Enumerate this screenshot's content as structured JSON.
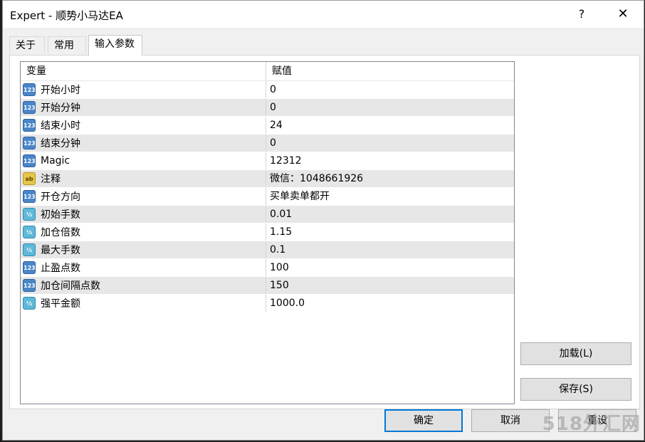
{
  "window": {
    "title": "Expert - 顺势小马达EA",
    "help_label": "?",
    "close_label": "✕"
  },
  "tabs": [
    {
      "label": "关于"
    },
    {
      "label": "常用"
    },
    {
      "label": "输入参数",
      "active": true
    }
  ],
  "grid": {
    "headers": {
      "variable": "变量",
      "value": "赋值"
    },
    "rows": [
      {
        "type": "int",
        "name": "开始小时",
        "value": "0"
      },
      {
        "type": "int",
        "name": "开始分钟",
        "value": "0"
      },
      {
        "type": "int",
        "name": "结束小时",
        "value": "24"
      },
      {
        "type": "int",
        "name": "结束分钟",
        "value": "0"
      },
      {
        "type": "int",
        "name": "Magic",
        "value": "12312"
      },
      {
        "type": "string",
        "name": "注释",
        "value": "微信：1048661926"
      },
      {
        "type": "int",
        "name": "开仓方向",
        "value": "买单卖单都开"
      },
      {
        "type": "double",
        "name": "初始手数",
        "value": "0.01"
      },
      {
        "type": "double",
        "name": "加仓倍数",
        "value": "1.15"
      },
      {
        "type": "double",
        "name": "最大手数",
        "value": "0.1"
      },
      {
        "type": "int",
        "name": "止盈点数",
        "value": "100"
      },
      {
        "type": "int",
        "name": "加仓间隔点数",
        "value": "150"
      },
      {
        "type": "double",
        "name": "强平金额",
        "value": "1000.0"
      }
    ]
  },
  "type_icons": {
    "int": "123",
    "string": "ab",
    "double": "½"
  },
  "buttons": {
    "load": "加载(L)",
    "save": "保存(S)",
    "ok": "确定",
    "cancel": "取消",
    "reset": "重设"
  },
  "watermark": "518外汇网"
}
